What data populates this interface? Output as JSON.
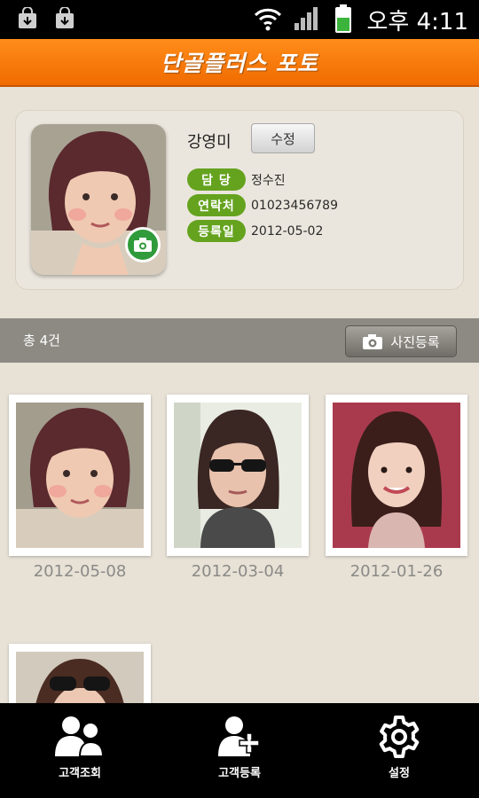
{
  "status_bar": {
    "time": "오후 4:11",
    "icons": [
      "shopping-bag-icon",
      "shopping-bag-icon",
      "wifi-icon",
      "signal-icon",
      "battery-icon"
    ]
  },
  "title": "단골플러스 포토",
  "profile": {
    "name": "강영미",
    "edit_label": "수정",
    "fields": [
      {
        "label": "담 당",
        "value": "정수진"
      },
      {
        "label": "연락처",
        "value": "01023456789"
      },
      {
        "label": "등록일",
        "value": "2012-05-02"
      }
    ]
  },
  "photos_bar": {
    "count_text": "총 4건",
    "register_label": "사진등록"
  },
  "photos": [
    {
      "date": "2012-05-08"
    },
    {
      "date": "2012-03-04"
    },
    {
      "date": "2012-01-26"
    },
    {
      "date": ""
    }
  ],
  "bottom_nav": [
    {
      "label": "고객조회",
      "icon": "customers-icon"
    },
    {
      "label": "고객등록",
      "icon": "add-customer-icon"
    },
    {
      "label": "설정",
      "icon": "settings-gear-icon"
    }
  ],
  "colors": {
    "accent_orange": "#f37a0a",
    "label_green": "#65a31f",
    "camera_green": "#2f9b3a",
    "background": "#e7e1d6"
  }
}
